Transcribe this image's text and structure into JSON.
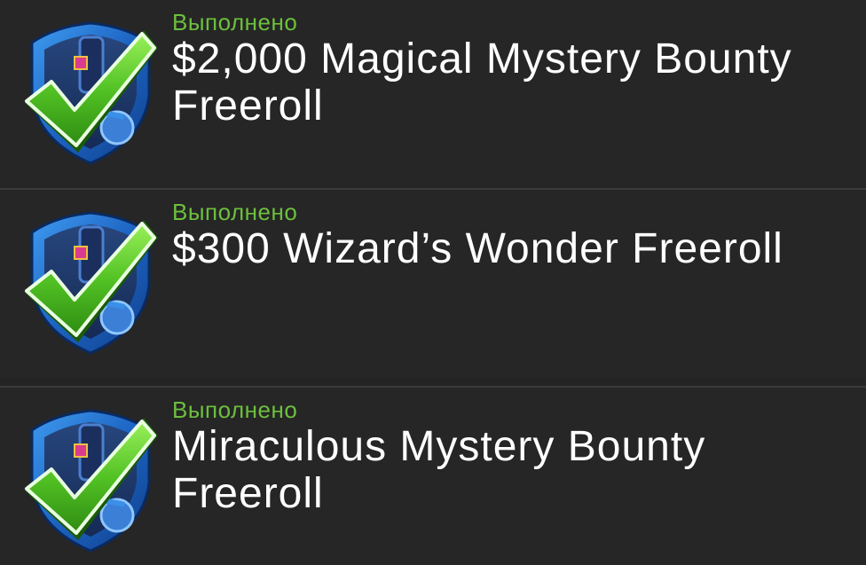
{
  "colors": {
    "background": "#262626",
    "status_green": "#6cc03d",
    "title_white": "#ffffff",
    "badge_blue": "#1e6fc4",
    "check_green": "#55c22b"
  },
  "missions": [
    {
      "status": "Выполнено",
      "title": "$2,000 Magical Mystery Bounty Freeroll",
      "icon": "completed-shield-check-icon"
    },
    {
      "status": "Выполнено",
      "title": "$300 Wizard’s Wonder Freeroll",
      "icon": "completed-shield-check-icon"
    },
    {
      "status": "Выполнено",
      "title": "Miraculous Mystery Bounty Freeroll",
      "icon": "completed-shield-check-icon"
    }
  ]
}
